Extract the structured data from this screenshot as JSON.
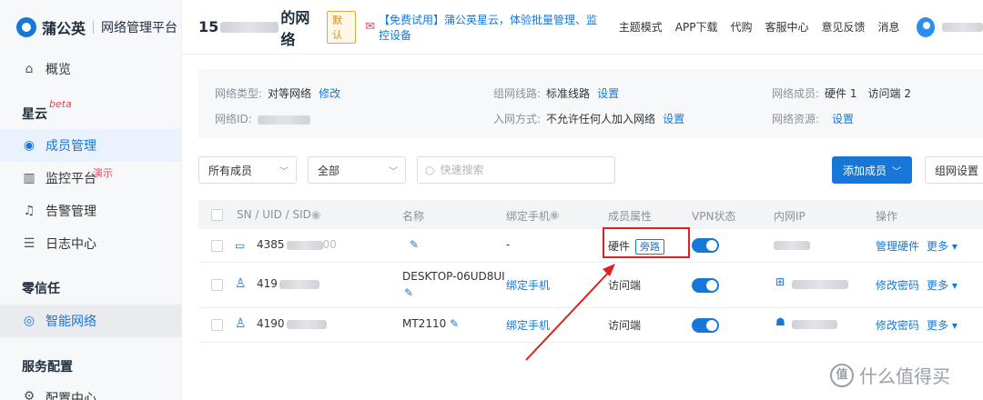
{
  "app": {
    "brand": "蒲公英",
    "subtitle": "网络管理平台"
  },
  "sidebar": {
    "items": [
      {
        "label": "概览",
        "icon": "home-icon"
      },
      {
        "label": "成员管理",
        "icon": "members-icon"
      },
      {
        "label": "监控平台",
        "icon": "monitor-icon"
      },
      {
        "label": "告警管理",
        "icon": "bell-icon"
      },
      {
        "label": "日志中心",
        "icon": "log-icon"
      },
      {
        "label": "智能网络",
        "icon": "network-icon"
      },
      {
        "label": "配置中心",
        "icon": "config-icon"
      }
    ],
    "sections": [
      "星云",
      "零信任",
      "服务配置"
    ],
    "tag_beta": "beta",
    "tag_demo": "演示"
  },
  "header": {
    "title_prefix": "15",
    "title_suffix": "的网络",
    "default_badge": "默认",
    "promo": "【免费试用】蒲公英星云，体验批量管理、监控设备",
    "links": [
      "主题模式",
      "APP下载",
      "代购",
      "客服中心",
      "意见反馈",
      "消息"
    ]
  },
  "info": {
    "net_type_label": "网络类型:",
    "net_type": "对等网络",
    "net_type_link": "修改",
    "net_id_label": "网络ID:",
    "line_label": "组网线路:",
    "line": "标准线路",
    "line_link": "设置",
    "join_label": "入网方式:",
    "join": "不允许任何人加入网络",
    "join_link": "设置",
    "members_label": "网络成员:",
    "members_hw": "硬件 1",
    "members_client": "访问端 2",
    "resources_label": "网络资源:",
    "resources_link": "设置"
  },
  "filters": {
    "members_select": "所有成员",
    "type_select": "全部",
    "search_placeholder": "快速搜索",
    "add_button": "添加成员",
    "group_button": "组网设置"
  },
  "table": {
    "headers": [
      "SN / UID / SID",
      "名称",
      "绑定手机",
      "成员属性",
      "VPN状态",
      "内网IP",
      "操作"
    ],
    "rows": [
      {
        "id": "4385",
        "id_tail": "00",
        "name": "",
        "phone": "-",
        "attr": "硬件",
        "attr_tag": "旁路",
        "action": "管理硬件",
        "more": "更多"
      },
      {
        "id": "419",
        "name": "DESKTOP-06UD8UI",
        "phone": "绑定手机",
        "attr": "访问端",
        "action": "修改密码",
        "more": "更多"
      },
      {
        "id": "4190",
        "name": "MT2110",
        "phone": "绑定手机",
        "attr": "访问端",
        "action": "修改密码",
        "more": "更多"
      }
    ]
  },
  "watermark": {
    "logo": "值",
    "text": "什么值得买"
  },
  "colors": {
    "accent": "#1677d8",
    "highlight": "#e02020"
  }
}
